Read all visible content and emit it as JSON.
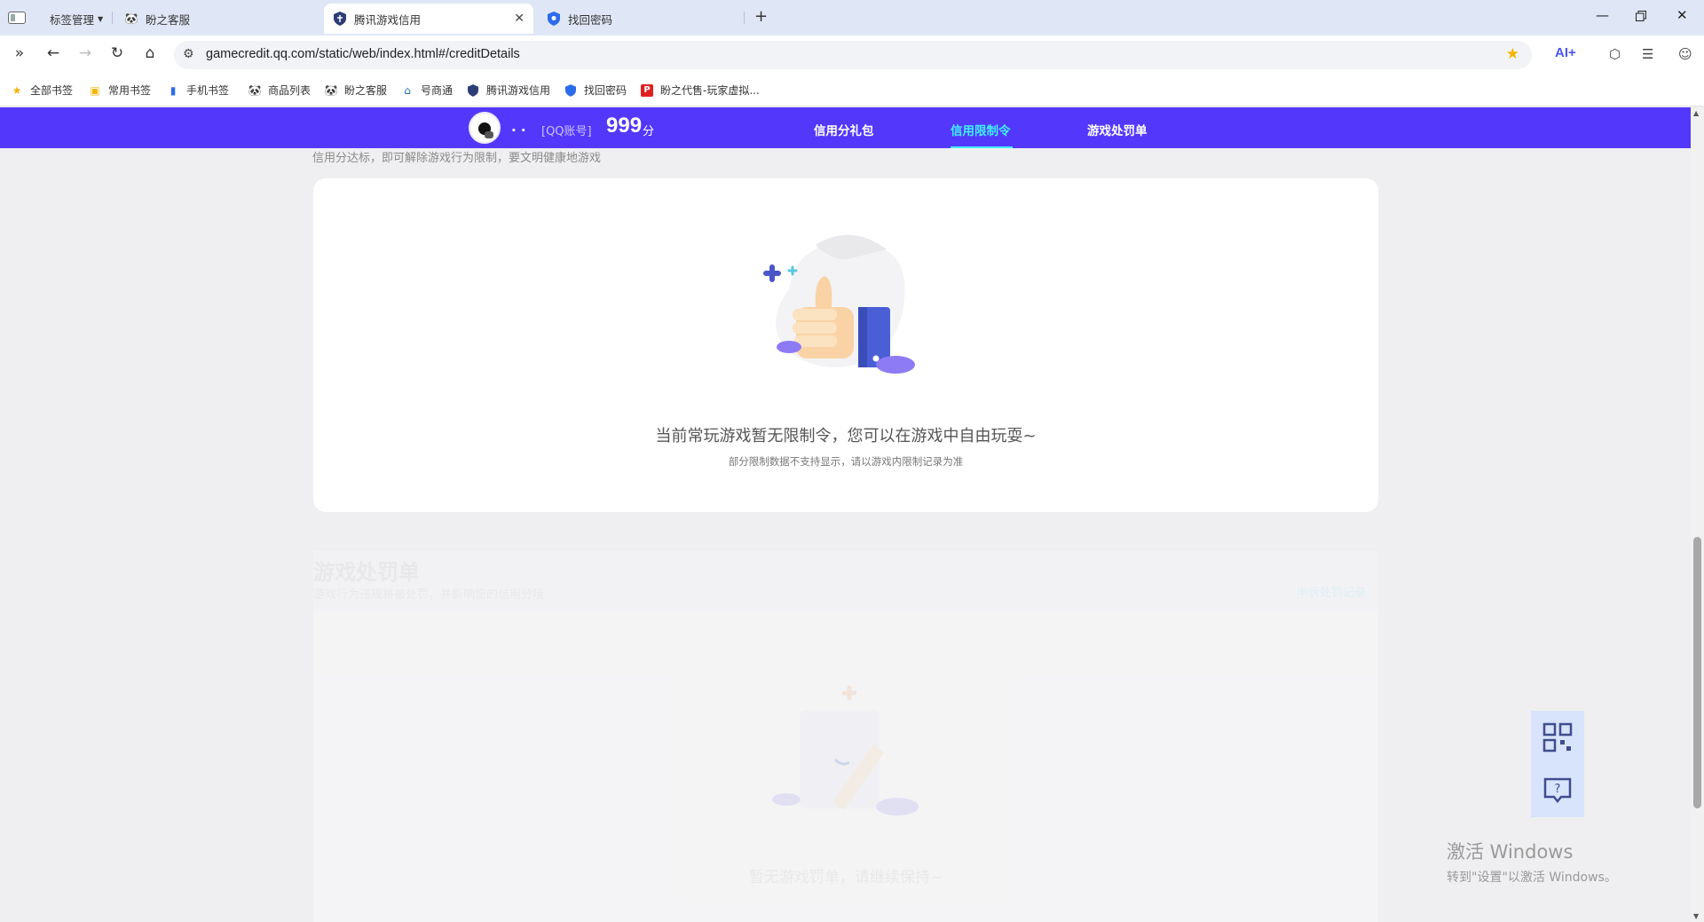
{
  "tabs": [
    {
      "label": "标签管理",
      "icon": "tab-manager-icon",
      "has_dropdown": true
    },
    {
      "label": "盼之客服",
      "icon": "panda-icon"
    },
    {
      "label": "腾讯游戏信用",
      "icon": "shield-icon",
      "active": true
    },
    {
      "label": "找回密码",
      "icon": "shield-blue-icon"
    }
  ],
  "toolbar": {
    "url": "gamecredit.qq.com/static/web/index.html#/creditDetails",
    "ai_label": "AI+"
  },
  "bookmarks": [
    {
      "label": "全部书签",
      "icon": "star-icon"
    },
    {
      "label": "常用书签",
      "icon": "bookmark-icon"
    },
    {
      "label": "手机书签",
      "icon": "phone-icon"
    },
    {
      "label": "商品列表",
      "icon": "panda-icon"
    },
    {
      "label": "盼之客服",
      "icon": "panda-icon"
    },
    {
      "label": "号商通",
      "icon": "home-icon"
    },
    {
      "label": "腾讯游戏信用",
      "icon": "shield-icon"
    },
    {
      "label": "找回密码",
      "icon": "shield-blue-icon"
    },
    {
      "label": "盼之代售-玩家虚拟...",
      "icon": "red-p-icon"
    }
  ],
  "header": {
    "nickname": ". .",
    "account_tag": "[QQ账号]",
    "score": "999",
    "score_unit": "分",
    "nav": [
      {
        "label": "信用分礼包"
      },
      {
        "label": "信用限制令",
        "active": true
      },
      {
        "label": "游戏处罚单"
      }
    ]
  },
  "restriction": {
    "tip": "信用分达标，即可解除游戏行为限制，要文明健康地游戏",
    "empty_title": "当前常玩游戏暂无限制令，您可以在游戏中自由玩耍~",
    "empty_note": "部分限制数据不支持显示，请以游戏内限制记录为准"
  },
  "penalty": {
    "title": "游戏处罚单",
    "subtitle": "游戏行为违规将被处罚，并影响您的信用分哦",
    "link": "申诉处罚记录",
    "empty_text": "暂无游戏罚单，请继续保持~"
  },
  "watermark": {
    "line1": "激活 Windows",
    "line2": "转到\"设置\"以激活 Windows。"
  },
  "colors": {
    "brand_purple": "#5338fb",
    "active_cyan": "#3ff0ff",
    "float_bg": "#d8e4fb"
  }
}
